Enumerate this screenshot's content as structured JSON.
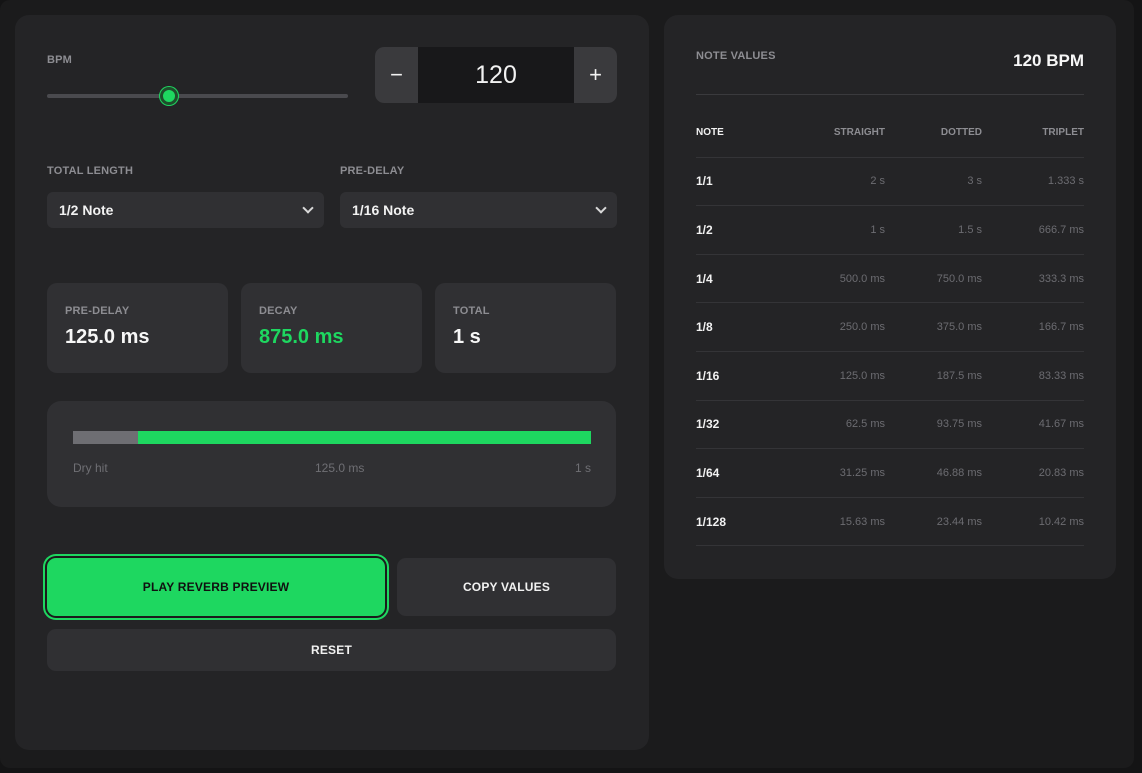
{
  "controls": {
    "bpm_label": "BPM",
    "bpm_value": "120",
    "bpm_slider_fraction": 0.405,
    "decrement_symbol": "−",
    "increment_symbol": "+",
    "total_length_label": "TOTAL LENGTH",
    "total_length_value": "1/2 Note",
    "predelay_label": "PRE-DELAY",
    "predelay_value": "1/16 Note"
  },
  "stats": {
    "predelay_label": "PRE-DELAY",
    "predelay_value": "125.0 ms",
    "decay_label": "DECAY",
    "decay_value": "875.0 ms",
    "total_label": "TOTAL",
    "total_value": "1 s"
  },
  "timeline": {
    "dry_fraction": 0.125,
    "start_label": "Dry hit",
    "mid_label": "125.0 ms",
    "end_label": "1 s"
  },
  "buttons": {
    "play_label": "PLAY REVERB PREVIEW",
    "copy_label": "COPY VALUES",
    "reset_label": "RESET"
  },
  "note_values": {
    "title": "NOTE VALUES",
    "bpm_display": "120 BPM",
    "headers": [
      "NOTE",
      "STRAIGHT",
      "DOTTED",
      "TRIPLET"
    ],
    "rows": [
      [
        "1/1",
        "2 s",
        "3 s",
        "1.333 s"
      ],
      [
        "1/2",
        "1 s",
        "1.5 s",
        "666.7 ms"
      ],
      [
        "1/4",
        "500.0 ms",
        "750.0 ms",
        "333.3 ms"
      ],
      [
        "1/8",
        "250.0 ms",
        "375.0 ms",
        "166.7 ms"
      ],
      [
        "1/16",
        "125.0 ms",
        "187.5 ms",
        "83.33 ms"
      ],
      [
        "1/32",
        "62.5 ms",
        "93.75 ms",
        "41.67 ms"
      ],
      [
        "1/64",
        "31.25 ms",
        "46.88 ms",
        "20.83 ms"
      ],
      [
        "1/128",
        "15.63 ms",
        "23.44 ms",
        "10.42 ms"
      ]
    ]
  },
  "colors": {
    "accent": "#1ed760",
    "panel": "#242426",
    "card": "#303033"
  }
}
